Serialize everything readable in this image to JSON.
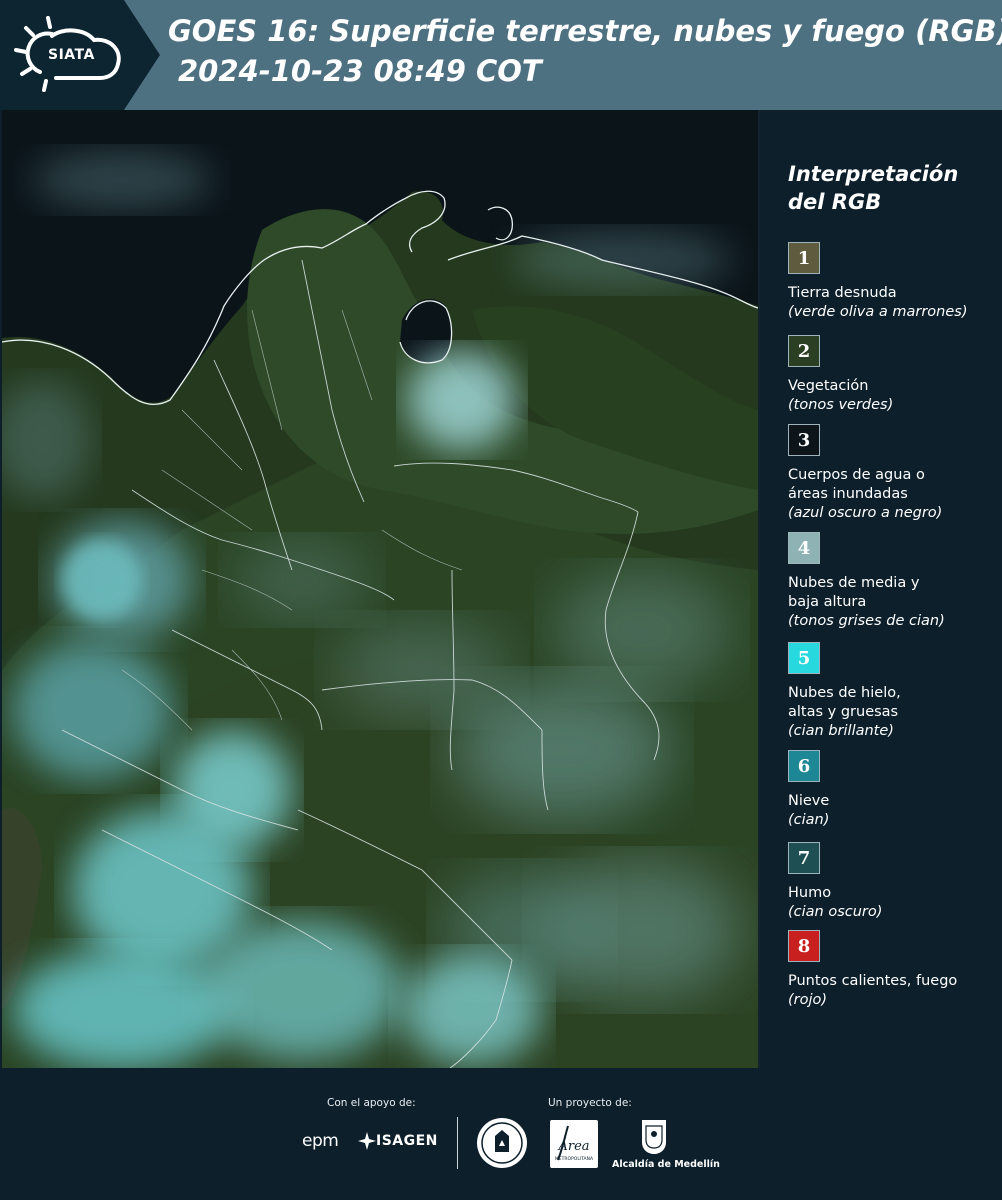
{
  "header": {
    "logo_text": "SIATA",
    "title": "GOES 16: Superficie terrestre, nubes y fuego (RGB)",
    "datetime": "2024-10-23 08:49 COT"
  },
  "legend": {
    "title_line1": "Interpretación",
    "title_line2": "del RGB",
    "items": [
      {
        "num": "1",
        "label1": "Tierra desnuda",
        "label2": "",
        "sub": "(verde oliva a marrones)",
        "color": "#5f5b3e"
      },
      {
        "num": "2",
        "label1": "Vegetación",
        "label2": "",
        "sub": "(tonos verdes)",
        "color": "#2b3f22"
      },
      {
        "num": "3",
        "label1": "Cuerpos de agua o",
        "label2": "áreas inundadas",
        "sub": "(azul oscuro a negro)",
        "color": "#0d151b"
      },
      {
        "num": "4",
        "label1": "Nubes de media y",
        "label2": "baja altura",
        "sub": "(tonos grises de cian)",
        "color": "#8fb3b5"
      },
      {
        "num": "5",
        "label1": "Nubes de hielo,",
        "label2": "altas y gruesas",
        "sub": "(cian brillante)",
        "color": "#27d9df"
      },
      {
        "num": "6",
        "label1": "Nieve",
        "label2": "",
        "sub": "(cian)",
        "color": "#1e8796"
      },
      {
        "num": "7",
        "label1": "Humo",
        "label2": "",
        "sub": "(cian oscuro)",
        "color": "#1d4f53"
      },
      {
        "num": "8",
        "label1": "Puntos calientes, fuego",
        "label2": "",
        "sub": "(rojo)",
        "color": "#c81f1f"
      }
    ]
  },
  "footer": {
    "support_label": "Con el apoyo de:",
    "project_label": "Un proyecto de:",
    "sponsors": [
      "epm",
      "ISAGEN"
    ],
    "partners": [
      "Área Metropolitana",
      "Alcaldía de Medellín"
    ],
    "amva_text": "Área",
    "amva_sub": "METROPOLITANA",
    "alcaldia_text": "Alcaldía de Medellín"
  }
}
